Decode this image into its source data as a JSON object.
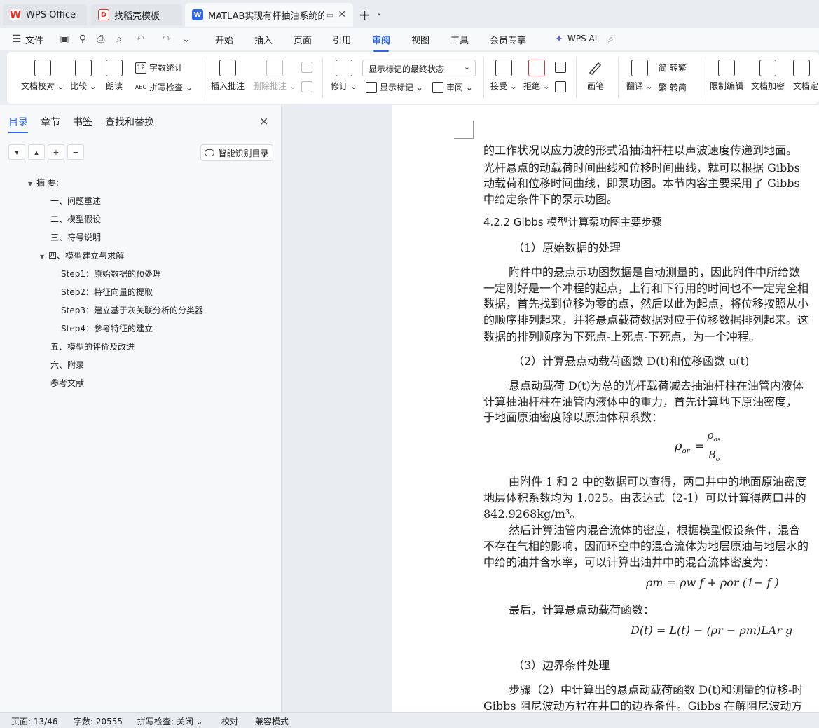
{
  "tabs": [
    {
      "label": "WPS Office"
    },
    {
      "label": "找稻壳模板"
    },
    {
      "label": "MATLAB实现有杆抽油系统的诊"
    }
  ],
  "menubar": {
    "file": "文件",
    "items": [
      "开始",
      "插入",
      "页面",
      "引用",
      "审阅",
      "视图",
      "工具",
      "会员专享"
    ],
    "ai": "WPS AI"
  },
  "ribbon": {
    "doc_check": "文档校对",
    "compare": "比较",
    "read_aloud": "朗读",
    "word_count": "字数统计",
    "spell_check": "拼写检查",
    "insert_comment": "插入批注",
    "delete_comment": "删除批注",
    "revise": "修订",
    "markup_select": "显示标记的最终状态",
    "show_markup": "显示标记",
    "review": "审阅",
    "accept": "接受",
    "reject": "拒绝",
    "pen": "画笔",
    "translate": "翻译",
    "to_traditional": "简 转繁",
    "to_simplified": "繁 转简",
    "restrict_edit": "限制编辑",
    "encrypt": "文档加密",
    "finalize": "文档定"
  },
  "nav": {
    "tabs": [
      "目录",
      "章节",
      "书签",
      "查找和替换"
    ],
    "smart_toc": "智能识别目录",
    "toc": [
      "摘 要:",
      "一、问题重述",
      "二、模型假设",
      "三、符号说明",
      "四、模型建立与求解",
      "Step1：原始数据的预处理",
      "Step2：特征向量的提取",
      "Step3：建立基于灰关联分析的分类器",
      "Step4：参考特征的建立",
      "五、模型的评价及改进",
      "六、附录",
      "参考文献"
    ]
  },
  "doc": {
    "lines": [
      "的工作状况以应力波的形式沿抽油杆柱以声波速度传递到地面。",
      "光杆悬点的动载荷时间曲线和位移时间曲线，就可以根据 Gibbs",
      "动载荷和位移时间曲线，即泵功图。本节内容主要采用了 Gibbs",
      "中给定条件下的泵示功图。",
      "4.2.2 Gibbs 模型计算泵功图主要步骤",
      "（1）原始数据的处理",
      "附件中的悬点示功图数据是自动测量的，因此附件中所给数",
      "一定刚好是一个冲程的起点，上行和下行用的时间也不一定完全相",
      "数据，首先找到位移为零的点，然后以此为起点，将位移按照从小",
      "的顺序排列起来，并将悬点载荷数据对应于位移数据排列起来。这",
      "数据的排列顺序为下死点-上死点-下死点，为一个冲程。",
      "（2）计算悬点动载荷函数 D(t)和位移函数 u(t)",
      "悬点动载荷 D(t)为总的光杆载荷减去抽油杆柱在油管内液体",
      "计算抽油杆柱在油管内液体中的重力，首先计算地下原油密度，",
      "于地面原油密度除以原油体积系数：",
      "由附件 1 和 2 中的数据可以查得，两口井中的地面原油密度",
      "地层体积系数均为 1.025。由表达式（2-1）可以计算得两口井的",
      "842.9268kg/m³。",
      "然后计算油管内混合流体的密度，根据模型假设条件，混合",
      "不存在气相的影响，因而环空中的混合流体为地层原油与地层水的",
      "中给的油井含水率，可以计算出油井中的混合流体密度为：",
      "最后，计算悬点动载荷函数：",
      "（3）边界条件处理",
      "步骤（2）中计算出的悬点动载荷函数 D(t)和测量的位移-时",
      "Gibbs 阻尼波动方程在井口的边界条件。Gibbs 在解阻尼波动方"
    ],
    "eq1_lhs": "ρ",
    "eq1_lhs_sub": "or",
    "eq1_num": "ρ",
    "eq1_num_sub": "os",
    "eq1_den": "B",
    "eq1_den_sub": "o",
    "eq2": "ρm = ρw f + ρor (1− f )",
    "eq3": "D(t) = L(t) − (ρr − ρm)LAr g"
  },
  "status": {
    "page": "页面: 13/46",
    "words": "字数: 20555",
    "spell": "拼写检查: 关闭",
    "proof": "校对",
    "compat": "兼容模式"
  }
}
